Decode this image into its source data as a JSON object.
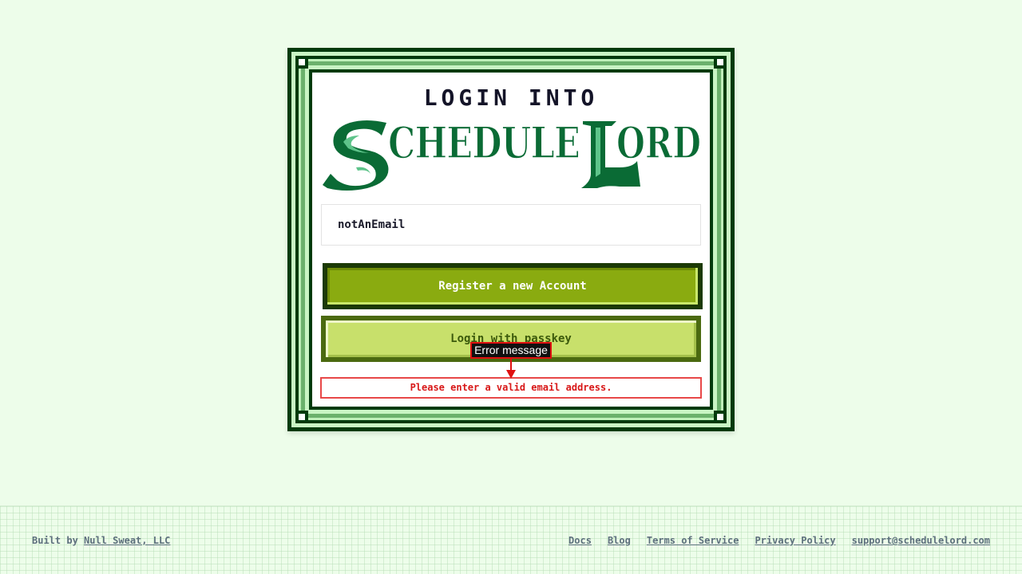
{
  "login": {
    "heading": "LOGIN INTO",
    "logo_text": "ScheduleLord",
    "email_value": "notAnEmail",
    "register_label": "Register a new Account",
    "passkey_label": "Login with passkey",
    "error_message": "Please enter a valid email address."
  },
  "annotation": {
    "label": "Error message",
    "color": "#e01010"
  },
  "footer": {
    "built_by_prefix": "Built by",
    "built_by_link": "Null Sweat, LLC",
    "links": [
      "Docs",
      "Blog",
      "Terms of Service",
      "Privacy Policy",
      "support@schedulelord.com"
    ]
  },
  "colors": {
    "background": "#edfdea",
    "frame_dark": "#003a0c",
    "logo_green": "#0a6b35",
    "register_button": "#8aab10",
    "passkey_button": "#c8e06b",
    "error_red": "#d81818"
  }
}
